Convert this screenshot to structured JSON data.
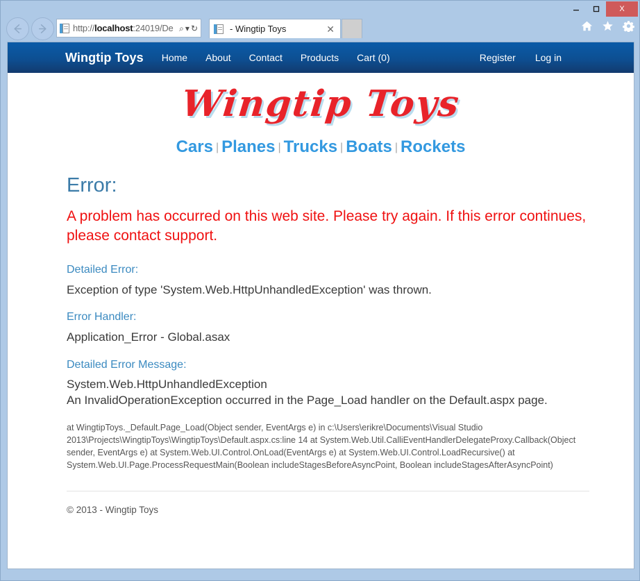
{
  "browser": {
    "window_controls": {
      "minimize_label": "Minimize",
      "maximize_label": "Maximize",
      "close_label": "X"
    },
    "chrome_icons": [
      {
        "name": "home-icon",
        "label": "Home"
      },
      {
        "name": "favorites-star-icon",
        "label": "Favorites"
      },
      {
        "name": "settings-gear-icon",
        "label": "Tools"
      }
    ],
    "back_label": "Back",
    "forward_label": "Forward",
    "address": {
      "scheme": "http://",
      "host": "localhost",
      "rest": ":24019/De",
      "full": "http://localhost:24019/De"
    },
    "addr_tools": {
      "search_icon": "search-icon",
      "dropdown_icon": "chevron-down-icon",
      "refresh_icon": "refresh-icon",
      "refresh_glyph": "↻",
      "search_glyph": "⌕",
      "dropdown_glyph": "▾"
    },
    "tab": {
      "title": "- Wingtip Toys",
      "close_glyph": "✕"
    },
    "new_tab_label": ""
  },
  "site": {
    "nav": {
      "brand": "Wingtip Toys",
      "links": [
        {
          "label": "Home"
        },
        {
          "label": "About"
        },
        {
          "label": "Contact"
        },
        {
          "label": "Products"
        },
        {
          "label": "Cart (0)"
        }
      ],
      "right_links": [
        {
          "label": "Register"
        },
        {
          "label": "Log in"
        }
      ]
    },
    "logo_text": "Wingtip Toys",
    "categories": [
      {
        "label": "Cars"
      },
      {
        "label": "Planes"
      },
      {
        "label": "Trucks"
      },
      {
        "label": "Boats"
      },
      {
        "label": "Rockets"
      }
    ],
    "category_separator": "|",
    "footer": {
      "copyright": "© 2013 - Wingtip Toys"
    }
  },
  "error_page": {
    "heading": "Error:",
    "message": "A problem has occurred on this web site. Please try again. If this error continues, please contact support.",
    "sections": [
      {
        "title": "Detailed Error:",
        "body": "Exception of type 'System.Web.HttpUnhandledException' was thrown."
      },
      {
        "title": "Error Handler:",
        "body": "Application_Error - Global.asax"
      }
    ],
    "detailed_message_title": "Detailed Error Message:",
    "detailed_message_body": "System.Web.HttpUnhandledException\nAn InvalidOperationException occurred in the Page_Load handler on the Default.aspx page.",
    "stack_trace": "at WingtipToys._Default.Page_Load(Object sender, EventArgs e) in c:\\Users\\erikre\\Documents\\Visual Studio 2013\\Projects\\WingtipToys\\WingtipToys\\Default.aspx.cs:line 14 at System.Web.Util.CalliEventHandlerDelegateProxy.Callback(Object sender, EventArgs e) at System.Web.UI.Control.OnLoad(EventArgs e) at System.Web.UI.Control.LoadRecursive() at System.Web.UI.Page.ProcessRequestMain(Boolean includeStagesBeforeAsyncPoint, Boolean includeStagesAfterAsyncPoint)"
  },
  "colors": {
    "chrome_bg": "#aec9e6",
    "nav_top": "#0a5ba8",
    "nav_bottom": "#123a6e",
    "logo_red": "#e8232a",
    "logo_shadow": "#b9dcee",
    "category_blue": "#3399e0",
    "heading_blue": "#3b7ba8",
    "error_red": "#ef1111",
    "close_btn_red": "#cf5a5a"
  }
}
